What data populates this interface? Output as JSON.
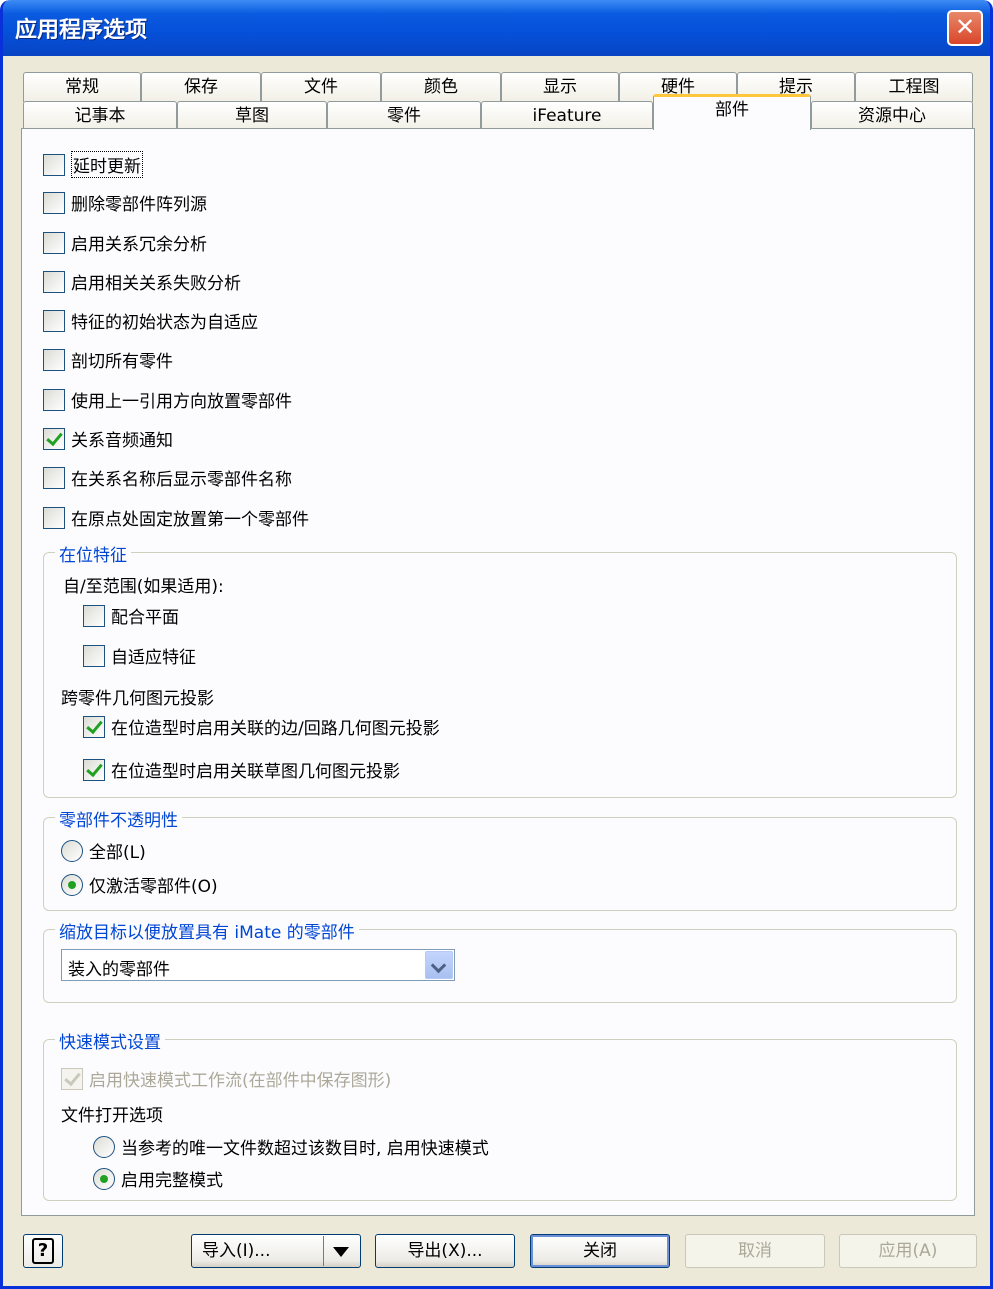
{
  "window": {
    "title": "应用程序选项",
    "close_label": "✕"
  },
  "tabs": {
    "row1": [
      "常规",
      "保存",
      "文件",
      "颜色",
      "显示",
      "硬件",
      "提示",
      "工程图"
    ],
    "row2": [
      "记事本",
      "草图",
      "零件",
      "iFeature",
      "部件",
      "资源中心"
    ],
    "active": "部件"
  },
  "options": {
    "delay_update": "延时更新",
    "delete_pattern_source": "删除零部件阵列源",
    "redundancy_analysis": "启用关系冗余分析",
    "failure_analysis": "启用相关关系失败分析",
    "adaptive_init": "特征的初始状态为自适应",
    "section_all": "剖切所有零件",
    "last_orientation": "使用上一引用方向放置零部件",
    "audio_notify": "关系音频通知",
    "show_names": "在关系名称后显示零部件名称",
    "ground_first": "在原点处固定放置第一个零部件"
  },
  "inplace": {
    "legend": "在位特征",
    "from_to_label": "自/至范围(如果适用):",
    "mate_plane": "配合平面",
    "adaptive_feature": "自适应特征",
    "cross_part_label": "跨零件几何图元投影",
    "edge_loop_projection": "在位造型时启用关联的边/回路几何图元投影",
    "sketch_projection": "在位造型时启用关联草图几何图元投影"
  },
  "opacity": {
    "legend": "零部件不透明性",
    "all": "全部(L)",
    "active_only": "仅激活零部件(O)"
  },
  "zoom": {
    "legend": "缩放目标以便放置具有 iMate 的零部件",
    "selected": "装入的零部件"
  },
  "express": {
    "legend": "快速模式设置",
    "enable_workflow": "启用快速模式工作流(在部件中保存图形)",
    "file_open_label": "文件打开选项",
    "express_when": "当参考的唯一文件数超过该数目时, 启用快速模式",
    "full_mode": "启用完整模式"
  },
  "buttons": {
    "help": "?",
    "import": "导入(I)...",
    "export": "导出(X)...",
    "close": "关闭",
    "cancel": "取消",
    "apply": "应用(A)"
  }
}
